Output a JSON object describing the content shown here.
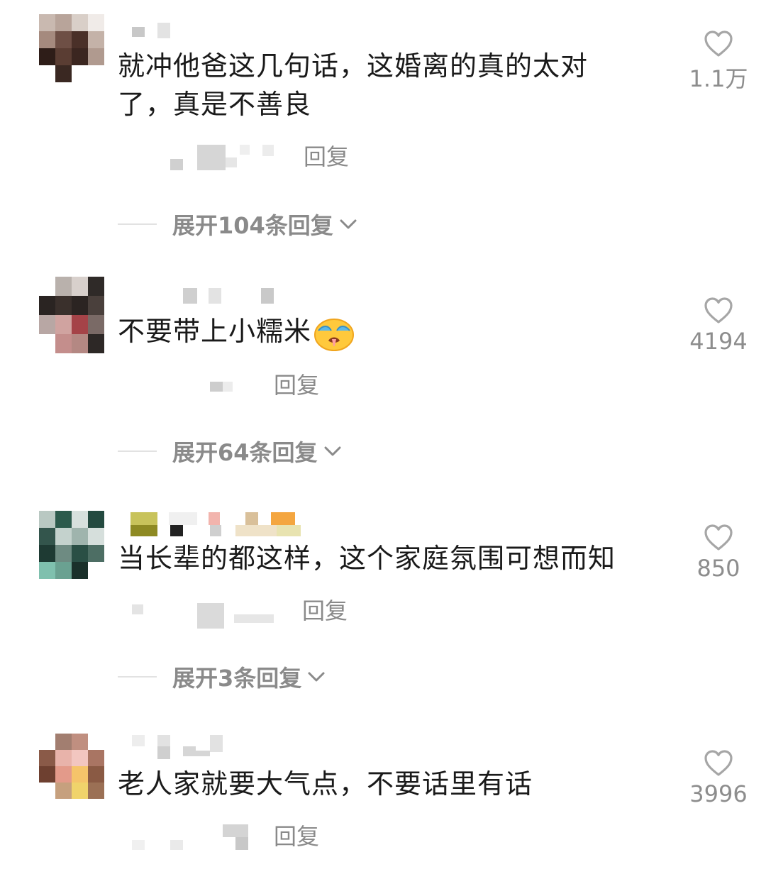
{
  "comments": [
    {
      "text_lines": [
        "就冲他爸这几句话，这婚离的真的太对",
        "了，真是不善良"
      ],
      "reply_label": "回复",
      "expand_label": "展开104条回复",
      "likes": "1.1万"
    },
    {
      "text_lines": [
        "不要带上小糯米"
      ],
      "emoji": "crying-face-emoji",
      "reply_label": "回复",
      "expand_label": "展开64条回复",
      "likes": "4194"
    },
    {
      "text_lines": [
        "当长辈的都这样，这个家庭氛围可想而知"
      ],
      "reply_label": "回复",
      "expand_label": "展开3条回复",
      "likes": "850"
    },
    {
      "text_lines": [
        "老人家就要大气点，不要话里有话"
      ],
      "reply_label": "回复",
      "likes": "3996"
    }
  ],
  "icons": {
    "like": "heart-outline-icon",
    "expand": "chevron-down-icon"
  }
}
